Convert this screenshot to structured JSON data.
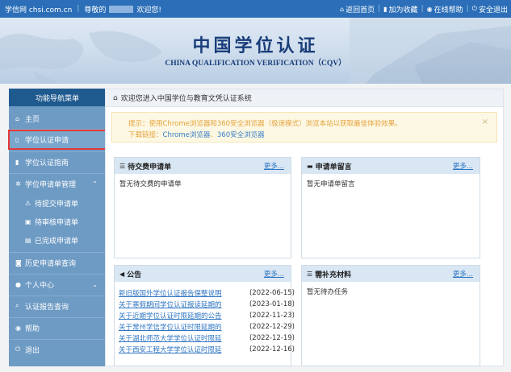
{
  "topbar": {
    "site": "学信网 chsi.com.cn",
    "greeting": "尊敬的",
    "welcome": "欢迎您!",
    "links": [
      {
        "icon": "home-icon",
        "label": "返回首页"
      },
      {
        "icon": "bookmark-icon",
        "label": "加为收藏"
      },
      {
        "icon": "help-icon",
        "label": "在线帮助"
      },
      {
        "icon": "power-icon",
        "label": "安全退出"
      }
    ]
  },
  "banner": {
    "title_cn": "中国学位认证",
    "title_en": "CHINA QUALIFICATION VERIFICATION（CQV）"
  },
  "sidebar": {
    "header": "功能导航菜单",
    "items": [
      {
        "icon": "home-icon",
        "label": "主页"
      },
      {
        "icon": "file-icon",
        "label": "学位认证申请"
      },
      {
        "icon": "bookmark-icon",
        "label": "学位认证指南"
      },
      {
        "icon": "gear-icon",
        "label": "学位申请单管理"
      },
      {
        "icon": "warning-icon",
        "label": "待提交申请单"
      },
      {
        "icon": "cart-icon",
        "label": "待审核申请单"
      },
      {
        "icon": "briefcase-icon",
        "label": "已完成申请单"
      },
      {
        "icon": "camera-icon",
        "label": "历史申请单查询"
      },
      {
        "icon": "user-icon",
        "label": "个人中心"
      },
      {
        "icon": "search-icon",
        "label": "认证报告查询"
      },
      {
        "icon": "help-icon",
        "label": "帮助"
      },
      {
        "icon": "power-icon",
        "label": "退出"
      }
    ]
  },
  "main": {
    "header": "欢迎您进入中国学位与教育文凭认证系统",
    "alert": {
      "line1": "提示：使用Chrome浏览器和360安全浏览器（极速模式）浏览本站以获取最佳体验效果。",
      "line2_prefix": "下载链接：",
      "link1": "Chrome浏览器",
      "link2": "360安全浏览器",
      "close": "×"
    },
    "panels": {
      "pending": {
        "title": "待交费申请单",
        "more": "更多...",
        "empty": "暂无待交费的申请单"
      },
      "messages": {
        "title": "申请单留言",
        "more": "更多...",
        "empty": "暂无申请单留言"
      },
      "notices": {
        "title": "公告",
        "more": "更多...",
        "rows": [
          {
            "title": "新旧版国外学位认证报告保整说明",
            "date": "(2022-06-15)"
          },
          {
            "title": "关于寒假期间学位认证报读延期的",
            "date": "(2023-01-18)"
          },
          {
            "title": "关于近期学位认证时限延期的公告",
            "date": "(2022-11-23)"
          },
          {
            "title": "关于常州学信学位认证时限延期的",
            "date": "(2022-12-29)"
          },
          {
            "title": "关于湖北师范大学学位认证时限延",
            "date": "(2022-12-19)"
          },
          {
            "title": "关于西安工程大学学位认证时限延",
            "date": "(2022-12-16)"
          }
        ]
      },
      "supplement": {
        "title": "需补充材料",
        "more": "更多...",
        "empty": "暂无待办任务"
      }
    }
  },
  "colors": {
    "topbar": "#2c6fb8",
    "sidebar": "#6e9bc4",
    "sidebar_header": "#1f5a8f",
    "highlight": "#e53935",
    "link": "#2f76c2",
    "alert_text": "#e6a23c"
  }
}
